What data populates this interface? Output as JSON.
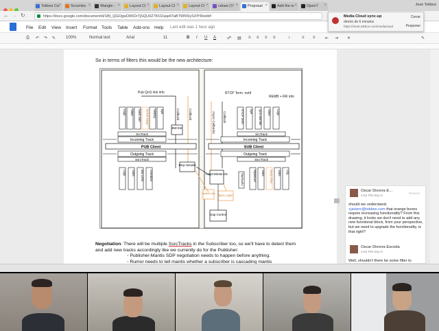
{
  "browser": {
    "tabs": [
      {
        "label": "Tokbox Ca",
        "color": "#3b6fd6"
      },
      {
        "label": "Scrumbo",
        "color": "#d9762b"
      },
      {
        "label": "Wangle -",
        "color": "#333333"
      },
      {
        "label": "Layout Cl",
        "color": "#e0b12e"
      },
      {
        "label": "Layout Cl",
        "color": "#e0b12e"
      },
      {
        "label": "Layout Cl",
        "color": "#e0b12e"
      },
      {
        "label": "cdraw (7/",
        "color": "#7a4fc2"
      },
      {
        "label": "Proposal",
        "color": "#3b6fd6"
      },
      {
        "label": "Add the w",
        "color": "#222222"
      },
      {
        "label": "OpenT",
        "color": "#222222"
      }
    ],
    "user": "Jose Tokbox",
    "url": "https://docs.google.com/document/d/1Bt_QGOgwD0KDrTjSQU0Z7KfJZaqe6TaBTWfX6ySXfY8/edit#"
  },
  "docs": {
    "menu": [
      "File",
      "Edit",
      "View",
      "Insert",
      "Format",
      "Tools",
      "Table",
      "Add-ons",
      "Help"
    ],
    "last_edit": "Last edit was 1 hour ago",
    "zoom": "100%",
    "style": "Normal text",
    "font": "Arial",
    "size": "11",
    "bold": "B",
    "italic": "I",
    "underline": "U",
    "text_color": "A"
  },
  "notification": {
    "title": "Media Cloud sync-up",
    "subtitle": "dentro de 6 minutos",
    "link": "https://meet.tokbox.com/mediacloud",
    "close": "Cerrar",
    "postpone": "Posponer"
  },
  "doc": {
    "intro": "So in terms of filters this would be the new architecture:",
    "para_bold": "Negotiation",
    "para_rest_1": ": There will be multiple ",
    "para_link": "SsrcTracks",
    "para_rest_2": " in the Subscriber too, so we'll have to detect them and add new tracks accordingly like we currently do for the Publisher:",
    "bullet1": "Publisher-Mantis SDP negotiation needs to happen before anything.",
    "bullet2": "Rumor needs to tell mantis whether a subscriber is cascading mantis"
  },
  "diagram": {
    "pub_label": "Pub QoS link info",
    "rtcp_label": "RTCP Term. notif",
    "remb_label": "REMB + RR info",
    "callback": "Callback",
    "async": "Async Callbacks",
    "bwe": "BW Est",
    "src_pub": "SrcTrack",
    "incoming": "Incoming Track",
    "pub_client": "PUB Client",
    "outgoing": "Outgoing Track",
    "ssrc": "SsrcTrack",
    "rtcp_sender": "Rtcp Sender",
    "target": "Target Bitrate Est.",
    "switch": "Switch Info",
    "sync": "Sync Layer",
    "gap": "Gap Control",
    "sub_client": "SUB Client",
    "left_top_filters": [
      "Logs",
      "Stats",
      "Nack Gen",
      "NACK Resp",
      "History",
      "Bye"
    ],
    "left_bot_filters": [
      "Logs",
      "Stats",
      "BW Limit",
      "Srandom"
    ],
    "right_top_filters": [
      "RTCP Term",
      "Bye",
      "QoS Monitor",
      "Stats",
      "Logs"
    ],
    "right_bot_filters": [
      "RtpMuxer",
      "Stats",
      "Resp Filter",
      "Stats",
      "Log"
    ],
    "mid_filter": "RtpMuxEx"
  },
  "comments": [
    {
      "name": "Oscar Divorra E...",
      "date": "4:54 PM Sep 6",
      "resolve": "Resolve",
      "text_pre": "should we understand, ",
      "mention": "+javierc@tokbox.com",
      "text_post": " that orange boxes require increasing functionality? From this drawing, it looks we don't need to add any new functional block, from your perspective, but we need to upgrade the functionality, is that right?"
    },
    {
      "name": "Oscar Divorra Escoda",
      "date": "4:54 PM Sep 6",
      "text": "Well, shouldn't there be some filter to"
    }
  ],
  "colors": {
    "orange": "#f0a55a",
    "box": "#ffffff",
    "line": "#111111",
    "diagram_bg": "#f6f5ee"
  }
}
